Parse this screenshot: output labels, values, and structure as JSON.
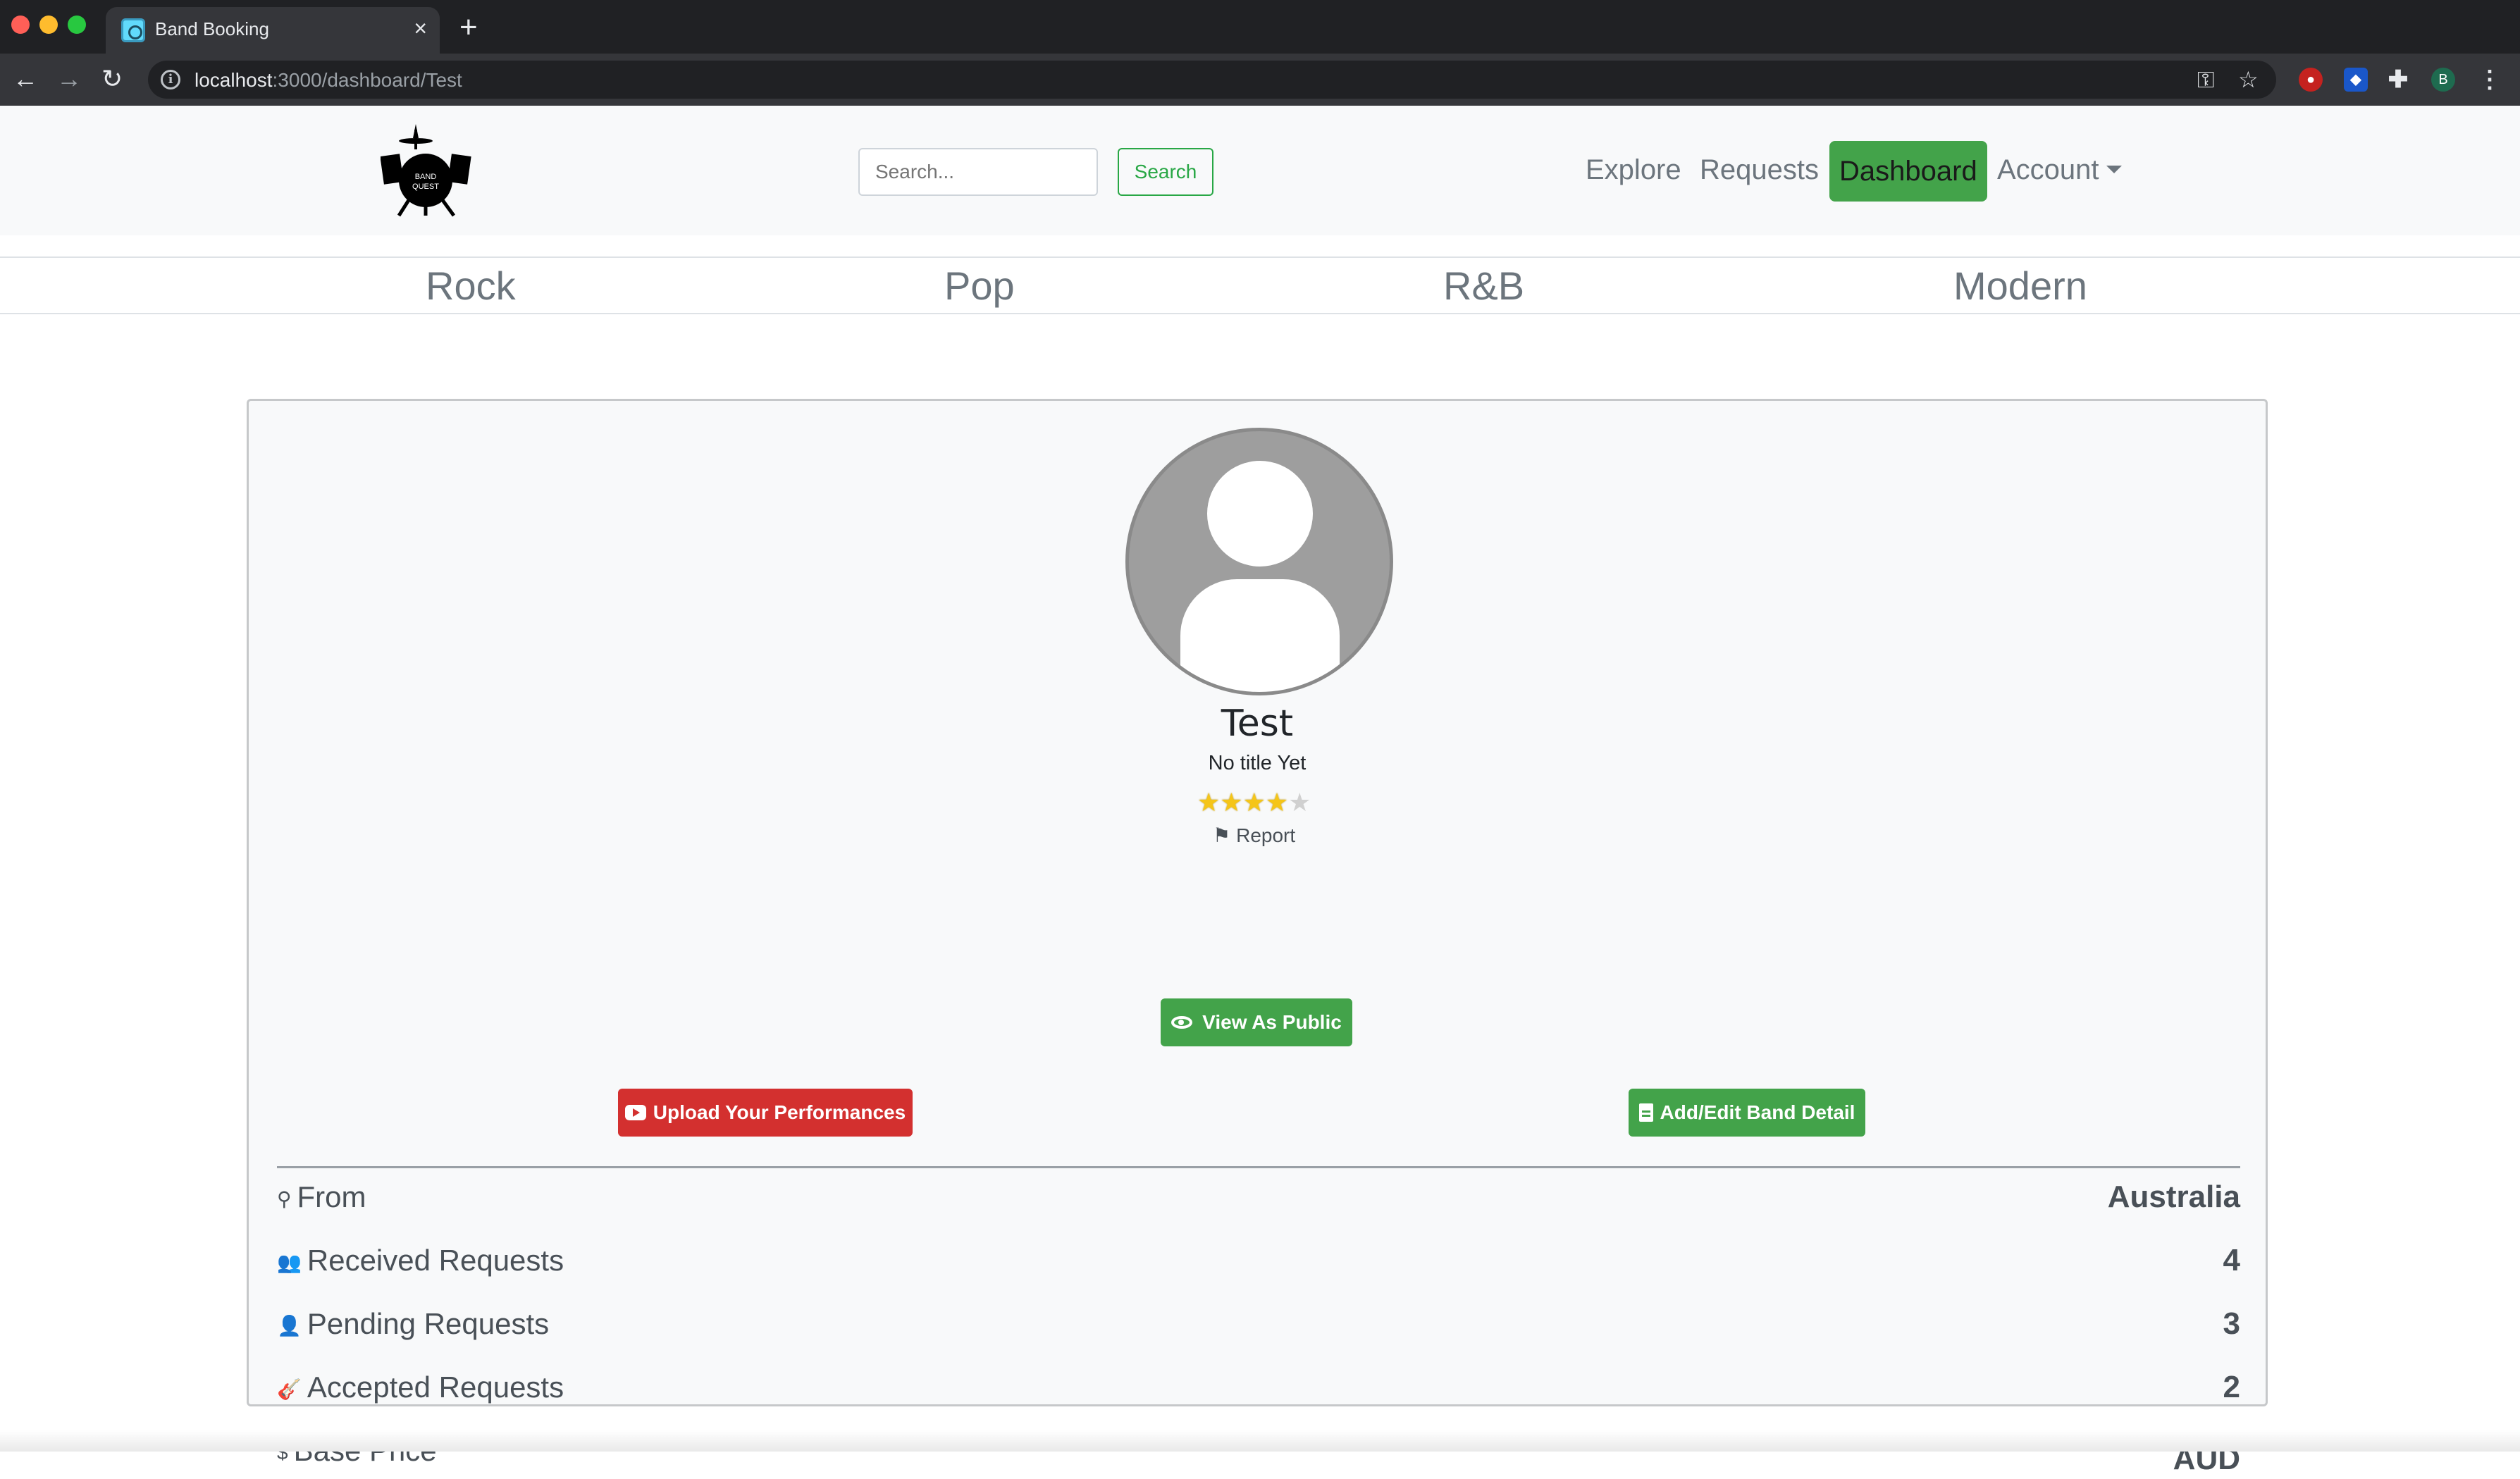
{
  "browser": {
    "tab_title": "Band Booking",
    "tab_close": "×",
    "new_tab": "+",
    "url_host": "localhost",
    "url_path": ":3000/dashboard/Test",
    "profile_initial": "B"
  },
  "navbar": {
    "search_placeholder": "Search...",
    "search_button": "Search",
    "links": {
      "explore": "Explore",
      "requests": "Requests",
      "dashboard": "Dashboard",
      "account": "Account"
    },
    "logo_text_1": "BAND",
    "logo_text_2": "QUEST"
  },
  "genres": [
    "Rock",
    "Pop",
    "R&B",
    "Modern"
  ],
  "profile": {
    "name": "Test",
    "title": "No title Yet",
    "rating": 4,
    "rating_max": 5,
    "report_label": "Report"
  },
  "actions": {
    "view_public": "View As Public",
    "upload": "Upload Your Performances",
    "edit_details": "Add/Edit Band Detail"
  },
  "stats": {
    "from": {
      "label": "From",
      "value": "Australia",
      "icon": "map-marker-icon"
    },
    "received": {
      "label": "Received Requests",
      "value": "4",
      "icon": "users-icon"
    },
    "pending": {
      "label": "Pending Requests",
      "value": "3",
      "icon": "user-icon"
    },
    "accepted": {
      "label": "Accepted Requests",
      "value": "2",
      "icon": "guitar-icon"
    },
    "base_price": {
      "label": "Base Price",
      "value": "AUD",
      "icon": "dollar-icon"
    }
  },
  "colors": {
    "accent_green": "#43a34a",
    "danger_red": "#d3302f",
    "star_gold": "#f5c518"
  }
}
